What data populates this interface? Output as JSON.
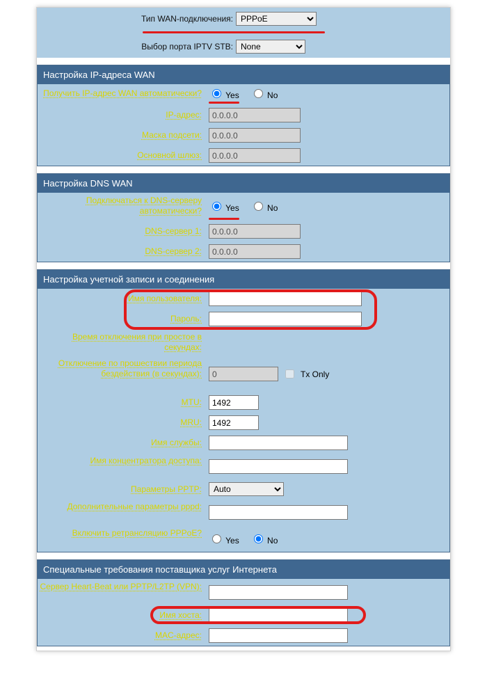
{
  "top": {
    "wan_type": {
      "label": "Тип WAN-подключения:",
      "value": "PPPoE",
      "underline_width": 134
    },
    "iptv": {
      "label": "Выбор порта IPTV STB:",
      "value": "None"
    }
  },
  "wan_ip": {
    "title": "Настройка IP-адреса WAN",
    "auto": {
      "label": "Получить IP-адрес WAN автоматически?",
      "yes": "Yes",
      "no": "No",
      "value": "yes"
    },
    "ip": {
      "label": "IP-адрес:",
      "value": "0.0.0.0"
    },
    "mask": {
      "label": "Маска подсети:",
      "value": "0.0.0.0"
    },
    "gw": {
      "label": "Основной шлюз:",
      "value": "0.0.0.0"
    }
  },
  "wan_dns": {
    "title": "Настройка DNS WAN",
    "auto": {
      "label": "Подключаться к DNS-серверу автоматически?",
      "yes": "Yes",
      "no": "No",
      "value": "yes"
    },
    "dns1": {
      "label": "DNS-сервер 1:",
      "value": "0.0.0.0"
    },
    "dns2": {
      "label": "DNS-сервер 2:",
      "value": "0.0.0.0"
    }
  },
  "acct": {
    "title": "Настройка учетной записи и соединения",
    "user": {
      "label": "Имя пользователя:",
      "value": ""
    },
    "pass": {
      "label": "Пароль:",
      "value": ""
    },
    "idle_lbl": "Время отключения при простое в секундах:",
    "idle2": {
      "label": "Отключение по прошествии периода бездействия (в секундах):",
      "value": "0",
      "txonly": "Tx Only"
    },
    "mtu": {
      "label": "MTU:",
      "value": "1492"
    },
    "mru": {
      "label": "MRU:",
      "value": "1492"
    },
    "svc": {
      "label": "Имя службы:",
      "value": ""
    },
    "ac": {
      "label": "Имя концентратора доступа:",
      "value": ""
    },
    "pptp": {
      "label": "Параметры PPTP:",
      "value": "Auto"
    },
    "pppd": {
      "label": "Дополнительные параметры pppd:",
      "value": ""
    },
    "relay": {
      "label": "Включить ретрансляцию PPPoE?",
      "yes": "Yes",
      "no": "No",
      "value": "no"
    }
  },
  "isp": {
    "title": "Специальные требования поставщика услуг Интернета",
    "hb": {
      "label": "Сервер Heart-Beat или PPTP/L2TP (VPN):",
      "value": ""
    },
    "host": {
      "label": "Имя хоста:",
      "value": ""
    },
    "mac": {
      "label": "MAC-адрес:",
      "value": ""
    }
  }
}
